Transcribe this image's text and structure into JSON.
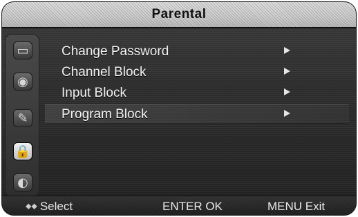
{
  "header": {
    "title": "Parental"
  },
  "sidebar": {
    "items": [
      {
        "name": "picture",
        "icon": "tv-screen-icon"
      },
      {
        "name": "sound",
        "icon": "speaker-icon"
      },
      {
        "name": "setup",
        "icon": "wrench-icon"
      },
      {
        "name": "parental",
        "icon": "lock-icon",
        "active": true
      },
      {
        "name": "channel",
        "icon": "satellite-dish-icon"
      }
    ]
  },
  "menu": {
    "items": [
      {
        "label": "Change Password"
      },
      {
        "label": "Channel Block"
      },
      {
        "label": "Input Block"
      },
      {
        "label": "Program Block",
        "selected": true
      }
    ]
  },
  "footer": {
    "select_glyph": "⬥⬥",
    "select_label": "Select",
    "enter_label": "ENTER OK",
    "exit_label": "MENU Exit"
  },
  "colors": {
    "title_bar": "#cfcfcf",
    "panel": "#2b2b2b",
    "text": "#f2f2f2"
  }
}
